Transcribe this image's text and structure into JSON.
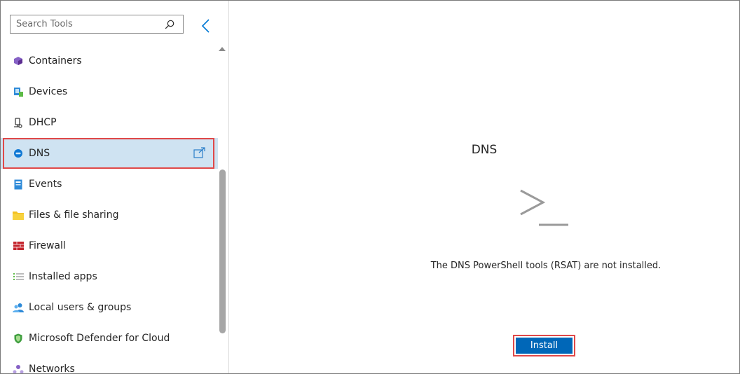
{
  "sidebar": {
    "search_placeholder": "Search Tools",
    "items": [
      {
        "label": "Containers",
        "icon": "containers-icon"
      },
      {
        "label": "Devices",
        "icon": "devices-icon"
      },
      {
        "label": "DHCP",
        "icon": "dhcp-icon"
      },
      {
        "label": "DNS",
        "icon": "dns-icon",
        "selected": true
      },
      {
        "label": "Events",
        "icon": "events-icon"
      },
      {
        "label": "Files & file sharing",
        "icon": "folder-icon"
      },
      {
        "label": "Firewall",
        "icon": "firewall-icon"
      },
      {
        "label": "Installed apps",
        "icon": "list-icon"
      },
      {
        "label": "Local users & groups",
        "icon": "users-icon"
      },
      {
        "label": "Microsoft Defender for Cloud",
        "icon": "shield-icon"
      },
      {
        "label": "Networks",
        "icon": "network-icon"
      }
    ]
  },
  "main": {
    "title": "DNS",
    "message": "The DNS PowerShell tools (RSAT) are not installed.",
    "install_label": "Install",
    "icon": "powershell-prompt-icon"
  },
  "colors": {
    "accent": "#0067b8",
    "selected_bg": "#cfe3f2",
    "highlight_border": "#e04848"
  }
}
